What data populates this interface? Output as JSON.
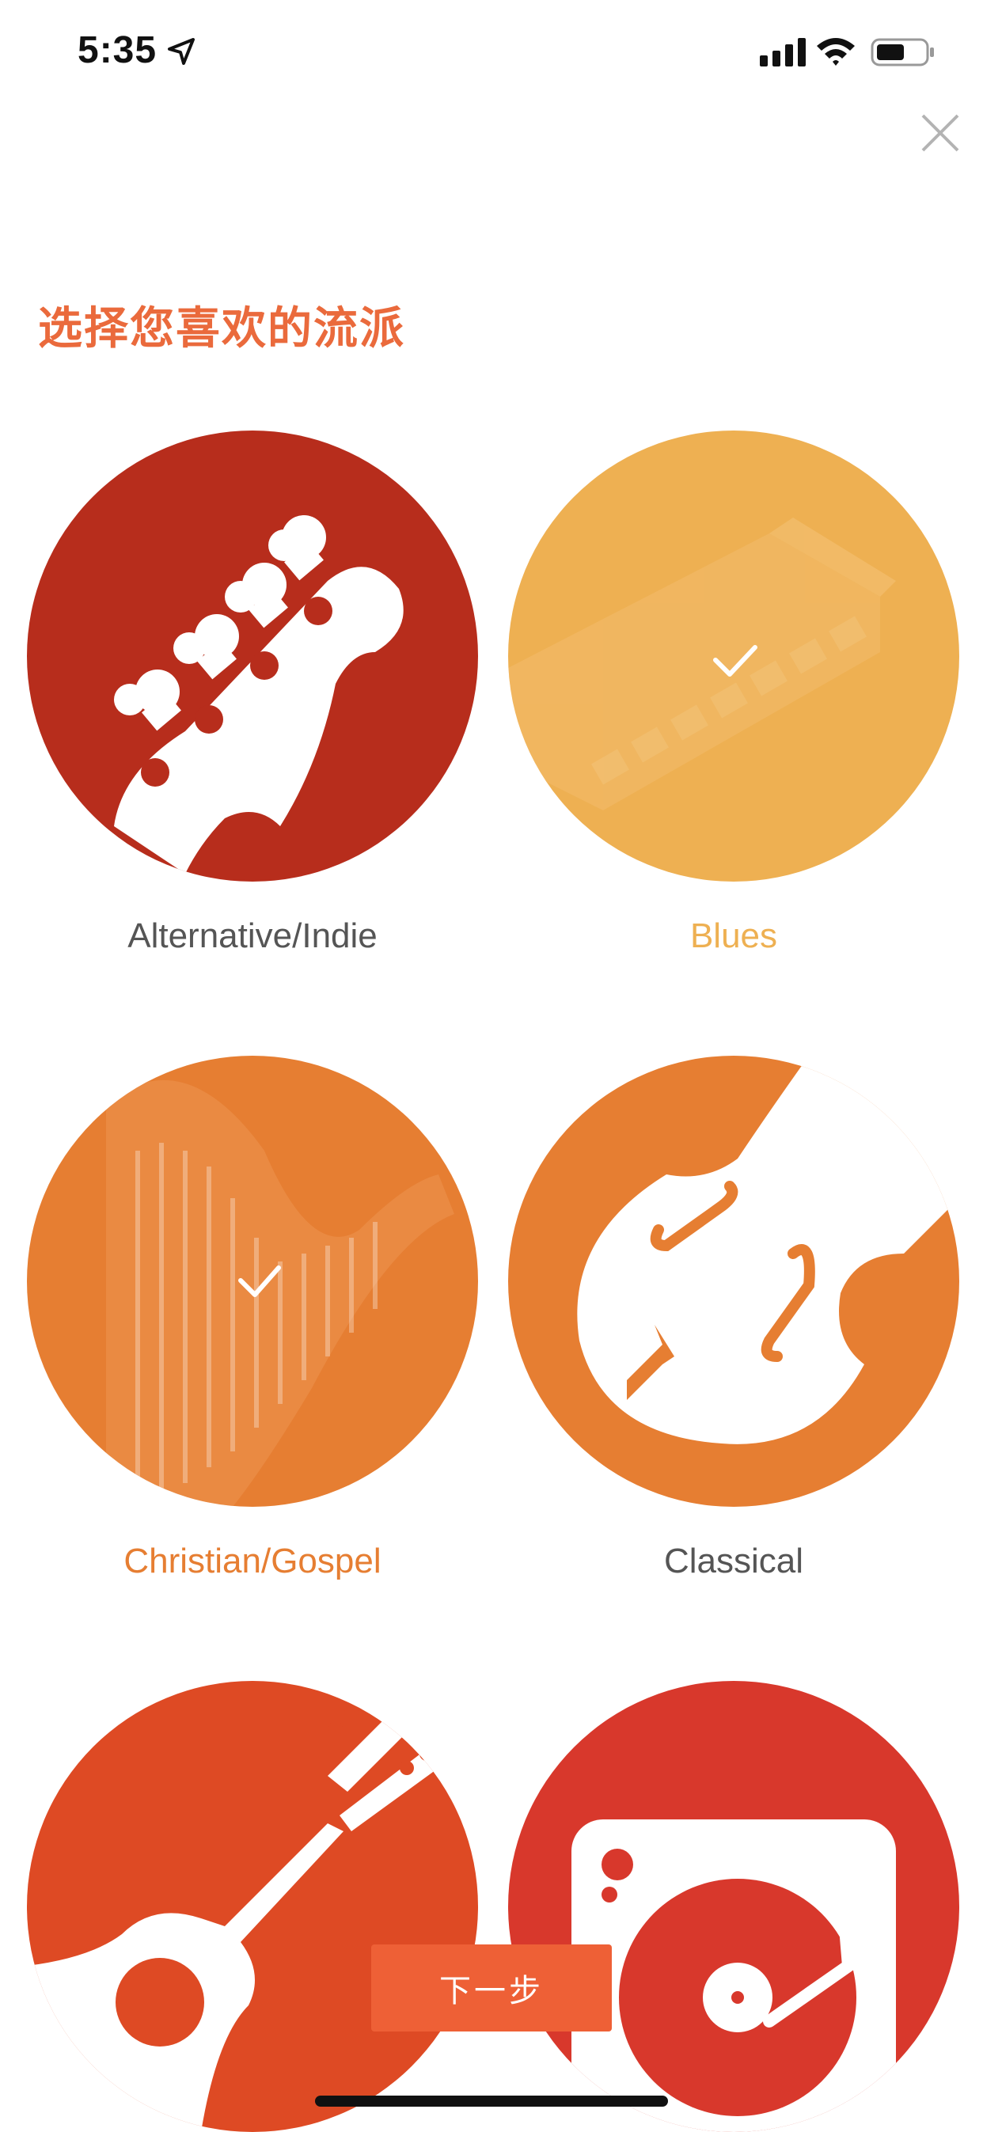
{
  "status": {
    "time": "5:35"
  },
  "title": "选择您喜欢的流派",
  "genres": [
    {
      "label": "Alternative/Indie",
      "selected": false,
      "color": "#b72d1c",
      "icon": "bass-guitar-headstock"
    },
    {
      "label": "Blues",
      "selected": true,
      "color": "#eeb052",
      "icon": "harmonica"
    },
    {
      "label": "Christian/Gospel",
      "selected": true,
      "color": "#e67e32",
      "icon": "harp"
    },
    {
      "label": "Classical",
      "selected": false,
      "color": "#e67e32",
      "icon": "violin"
    },
    {
      "label": "",
      "selected": false,
      "color": "#de4a24",
      "icon": "acoustic-guitar"
    },
    {
      "label": "",
      "selected": false,
      "color": "#d8382c",
      "icon": "turntable"
    }
  ],
  "next_button": {
    "label": "下一步",
    "color": "#ee6036"
  },
  "colors": {
    "accent": "#ea6a3c",
    "label_default": "#555555"
  }
}
